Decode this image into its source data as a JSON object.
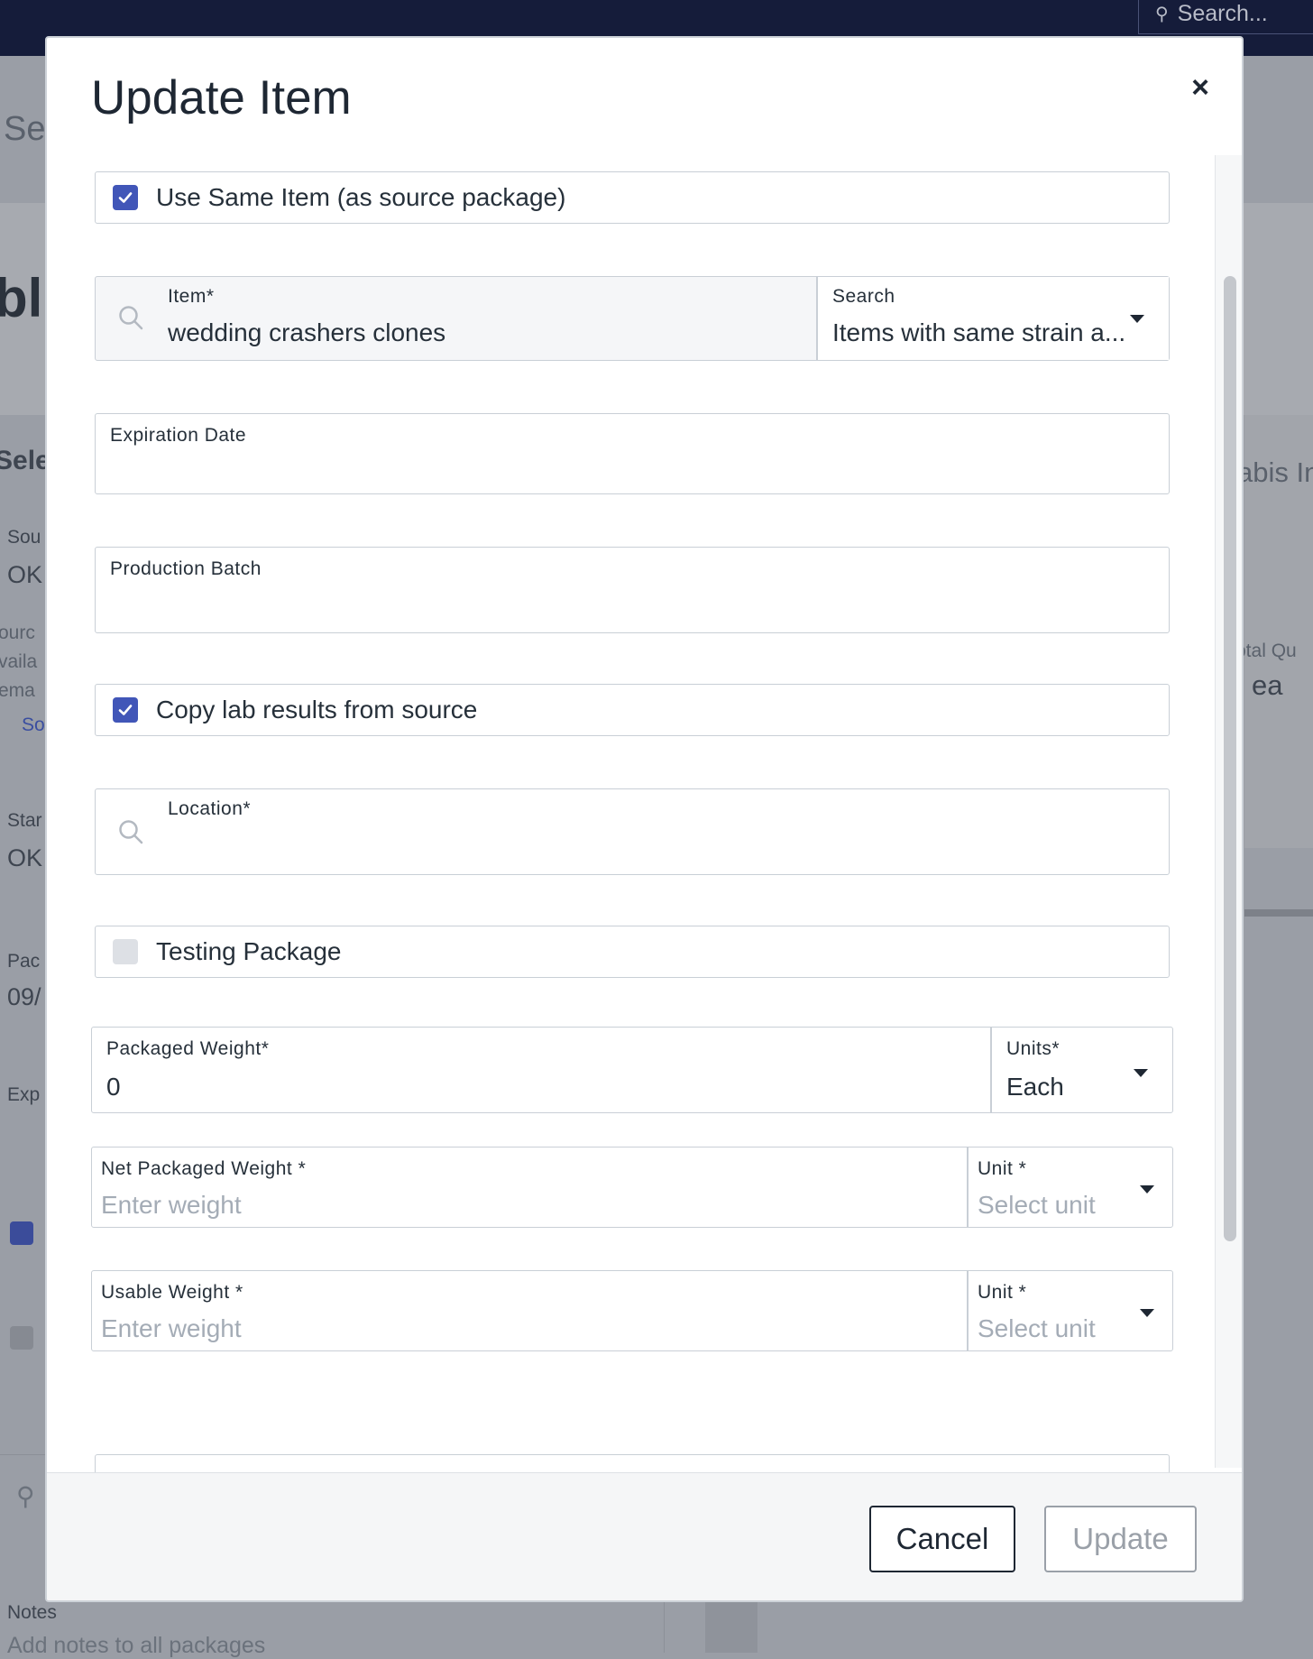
{
  "background": {
    "search_placeholder": "Search...",
    "texts": [
      "Se",
      "bli",
      "Sele",
      "Sou",
      "OK",
      "ourc",
      "vaila",
      "ema",
      "So",
      "Star",
      "OK",
      "Pac",
      "09/",
      "Exp",
      "abis In",
      "otal Qu",
      "ea"
    ],
    "notes_label": "Notes",
    "notes_placeholder": "Add notes to all packages"
  },
  "modal": {
    "title": "Update Item",
    "close_symbol": "×",
    "use_same_item": {
      "label": "Use Same Item (as source package)",
      "checked": true
    },
    "item": {
      "label": "Item*",
      "value": "wedding crashers clones"
    },
    "search": {
      "label": "Search",
      "value": "Items with same strain a..."
    },
    "expiration_date": {
      "label": "Expiration Date",
      "value": ""
    },
    "production_batch": {
      "label": "Production Batch",
      "value": ""
    },
    "copy_lab_results": {
      "label": "Copy lab results from source",
      "checked": true
    },
    "location": {
      "label": "Location*",
      "value": ""
    },
    "testing_package": {
      "label": "Testing Package",
      "checked": false
    },
    "packaged_weight": {
      "label": "Packaged Weight*",
      "value": "0"
    },
    "units": {
      "label": "Units*",
      "value": "Each"
    },
    "net_packaged_weight": {
      "label": "Net Packaged Weight *",
      "placeholder": "Enter weight"
    },
    "net_unit": {
      "label": "Unit *",
      "placeholder": "Select unit"
    },
    "usable_weight": {
      "label": "Usable Weight *",
      "placeholder": "Enter weight"
    },
    "usable_unit": {
      "label": "Unit *",
      "placeholder": "Select unit"
    },
    "cancel_label": "Cancel",
    "update_label": "Update"
  },
  "colors": {
    "accent": "#4156b8",
    "topbar": "#151c3a"
  }
}
